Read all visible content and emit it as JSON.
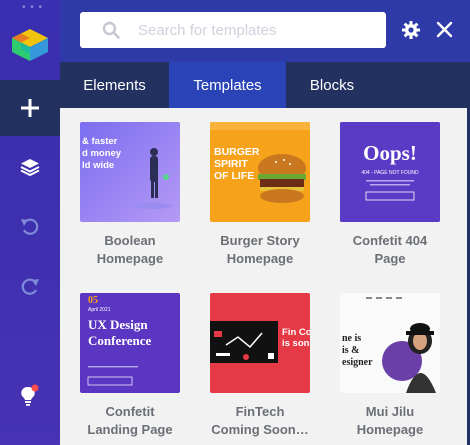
{
  "search": {
    "placeholder": "Search for templates"
  },
  "tabs": [
    {
      "label": "Elements"
    },
    {
      "label": "Templates"
    },
    {
      "label": "Blocks"
    }
  ],
  "templates": [
    {
      "title_line1": "Boolean",
      "title_line2": "Homepage",
      "thumb_text": [
        "& faster",
        "d money",
        "ld wide"
      ]
    },
    {
      "title_line1": "Burger Story",
      "title_line2": "Homepage",
      "thumb_text": [
        "BURGER",
        "SPIRIT",
        "OF LIFE"
      ]
    },
    {
      "title_line1": "Confetit 404",
      "title_line2": "Page",
      "thumb_text": [
        "Oops!",
        "404 - PAGE NOT FOUND"
      ]
    },
    {
      "title_line1": "Confetit",
      "title_line2": "Landing Page",
      "thumb_text": [
        "05",
        "April 2021",
        "UX Design",
        "Conference"
      ]
    },
    {
      "title_line1": "FinTech",
      "title_line2": "Coming Soon…",
      "thumb_text": [
        "Fin Co",
        "is son"
      ]
    },
    {
      "title_line1": "Mui Jilu",
      "title_line2": "Homepage",
      "thumb_text": [
        "ne is",
        "is &",
        "esigner"
      ]
    }
  ],
  "colors": {
    "rail": "#3d2fae",
    "tab_active": "#2a44b8",
    "tab_inactive": "#22315f",
    "content_bg": "#f2f2f2"
  }
}
